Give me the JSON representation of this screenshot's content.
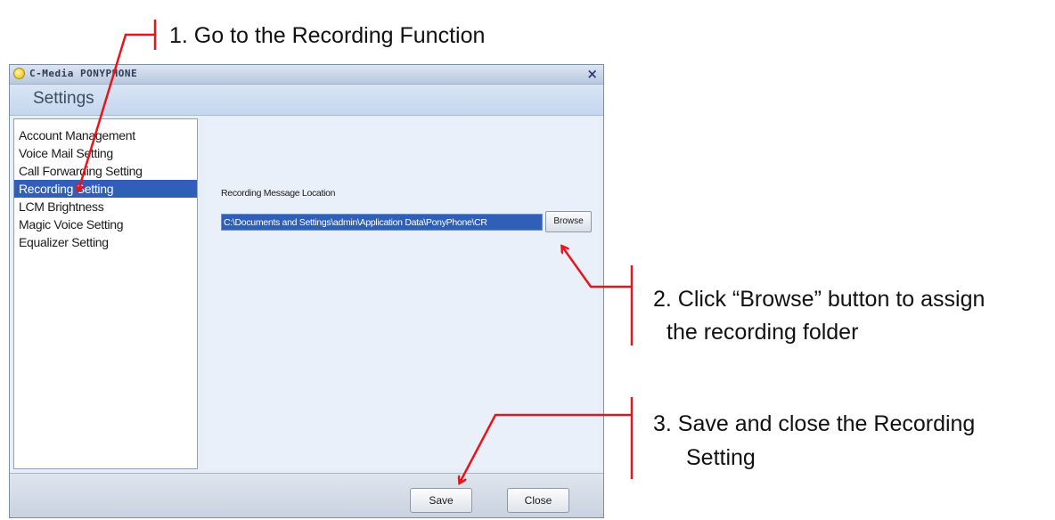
{
  "annotations": {
    "step1": "1. Go to the Recording Function",
    "step2_line1": "2. Click “Browse” button to assign",
    "step2_line2": "the recording folder",
    "step3_line1": "3. Save and close the Recording",
    "step3_line2": "Setting"
  },
  "window": {
    "app_title": "C-Media PONYPHONE",
    "close_glyph": "×",
    "header": "Settings"
  },
  "sidebar": {
    "items": [
      {
        "label": "Account Management"
      },
      {
        "label": "Voice Mail Setting"
      },
      {
        "label": "Call Forwarding Setting"
      },
      {
        "label": "Recording Setting",
        "selected": true
      },
      {
        "label": "LCM Brightness"
      },
      {
        "label": "Magic Voice Setting"
      },
      {
        "label": "Equalizer Setting"
      }
    ]
  },
  "recording": {
    "location_label": "Recording Message Location",
    "path_value": "C:\\Documents and Settings\\admin\\Application Data\\PonyPhone\\CR",
    "browse_label": "Browse"
  },
  "footer": {
    "save_label": "Save",
    "close_label": "Close"
  },
  "colors": {
    "selection": "#2f5fb6",
    "callout": "#e8141a"
  }
}
